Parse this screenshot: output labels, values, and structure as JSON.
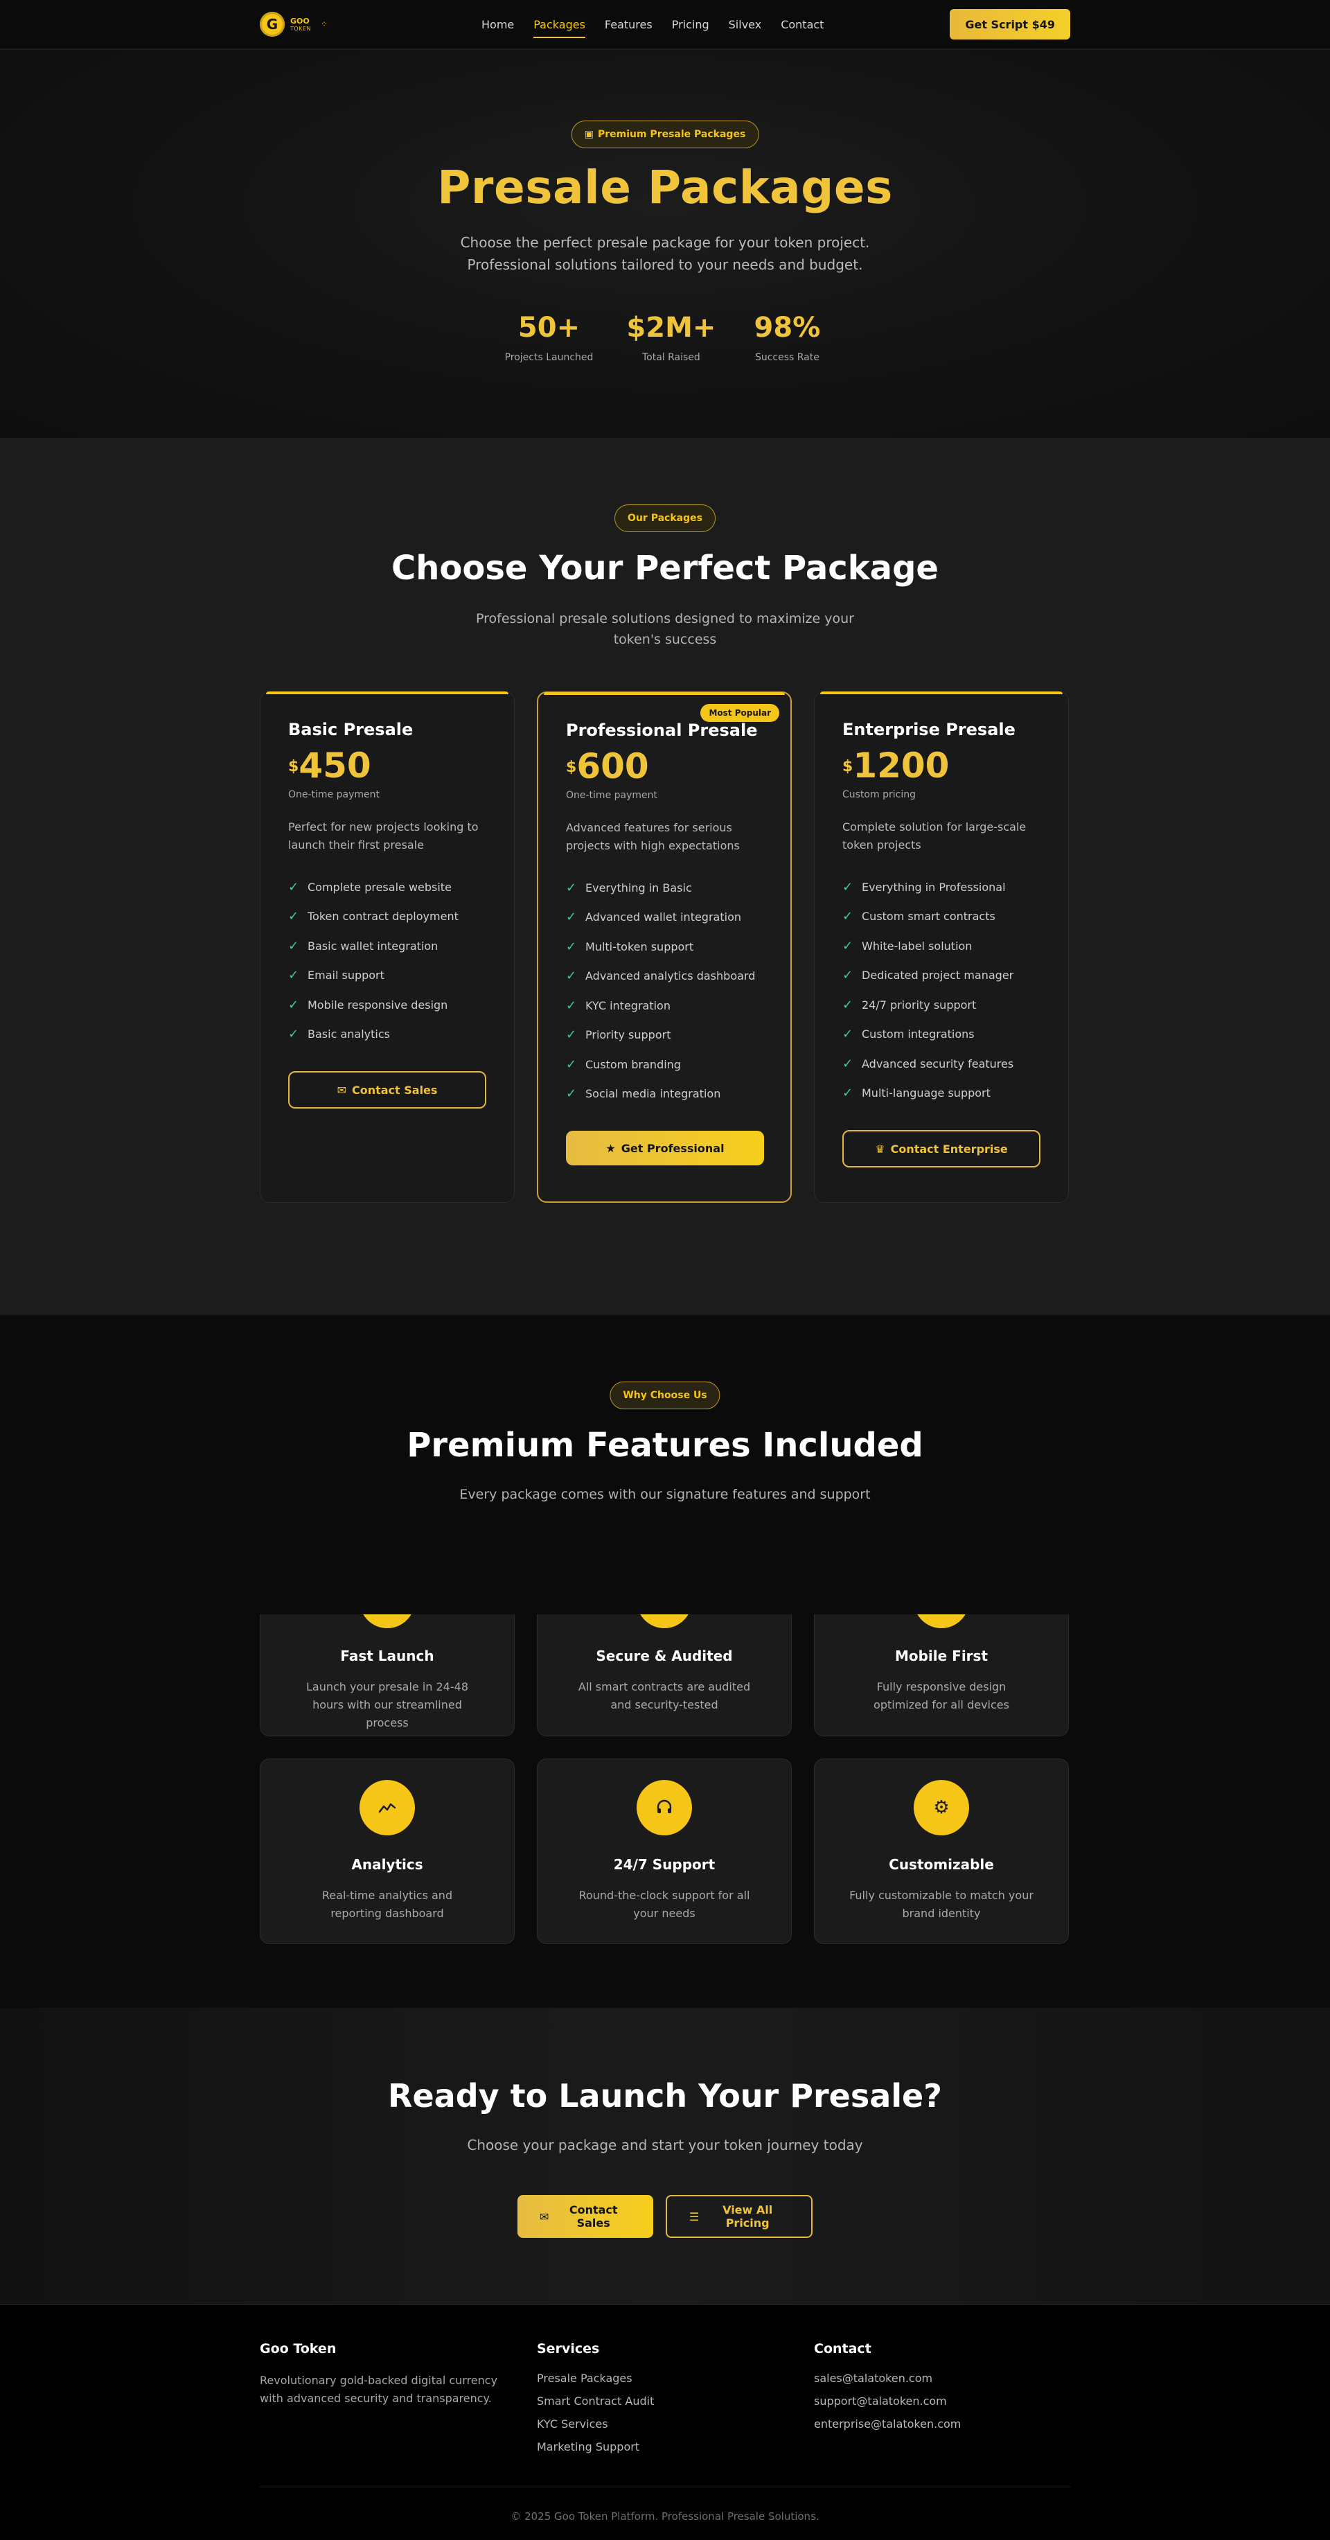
{
  "nav": {
    "logo_letter": "G",
    "logo_name": "GOO",
    "logo_sub": "TOKEN",
    "links": [
      "Home",
      "Packages",
      "Features",
      "Pricing",
      "Silvex",
      "Contact"
    ],
    "active": "Packages",
    "cta": "Get Script $49"
  },
  "hero": {
    "pill": "Premium Presale Packages",
    "title": "Presale Packages",
    "subtitle_line1": "Choose the perfect presale package for your token project.",
    "subtitle_line2": "Professional solutions tailored to your needs and budget.",
    "stats": [
      {
        "value": "50+",
        "label": "Projects Launched"
      },
      {
        "value": "$2M+",
        "label": "Total Raised"
      },
      {
        "value": "98%",
        "label": "Success Rate"
      }
    ]
  },
  "packages": {
    "pill": "Our Packages",
    "title": "Choose Your Perfect Package",
    "subtitle": "Professional presale solutions designed to maximize your token's success",
    "cards": [
      {
        "name": "Basic Presale",
        "currency": "$",
        "price": "450",
        "note": "One-time payment",
        "description": "Perfect for new projects looking to launch their first presale",
        "features": [
          "Complete presale website",
          "Token contract deployment",
          "Basic wallet integration",
          "Email support",
          "Mobile responsive design",
          "Basic analytics"
        ],
        "button": "Contact Sales",
        "button_icon": "mail-icon"
      },
      {
        "name": "Professional Presale",
        "badge": "Most Popular",
        "currency": "$",
        "price": "600",
        "note": "One-time payment",
        "description": "Advanced features for serious projects with high expectations",
        "features": [
          "Everything in Basic",
          "Advanced wallet integration",
          "Multi-token support",
          "Advanced analytics dashboard",
          "KYC integration",
          "Priority support",
          "Custom branding",
          "Social media integration"
        ],
        "button": "Get Professional",
        "button_icon": "star-icon"
      },
      {
        "name": "Enterprise Presale",
        "currency": "$",
        "price": "1200",
        "note": "Custom pricing",
        "description": "Complete solution for large-scale token projects",
        "features": [
          "Everything in Professional",
          "Custom smart contracts",
          "White-label solution",
          "Dedicated project manager",
          "24/7 priority support",
          "Custom integrations",
          "Advanced security features",
          "Multi-language support"
        ],
        "button": "Contact Enterprise",
        "button_icon": "crown-icon"
      }
    ]
  },
  "why": {
    "pill": "Why Choose Us",
    "title": "Premium Features Included",
    "subtitle": "Every package comes with our signature features and support",
    "features": [
      {
        "icon": "rocket-icon",
        "title": "Fast Launch",
        "desc": "Launch your presale in 24-48 hours with our streamlined process"
      },
      {
        "icon": "shield-icon",
        "title": "Secure & Audited",
        "desc": "All smart contracts are audited and security-tested"
      },
      {
        "icon": "mobile-icon",
        "title": "Mobile First",
        "desc": "Fully responsive design optimized for all devices"
      },
      {
        "icon": "chart-icon",
        "title": "Analytics",
        "desc": "Real-time analytics and reporting dashboard"
      },
      {
        "icon": "headset-icon",
        "title": "24/7 Support",
        "desc": "Round-the-clock support for all your needs"
      },
      {
        "icon": "gear-icon",
        "title": "Customizable",
        "desc": "Fully customizable to match your brand identity"
      }
    ]
  },
  "cta": {
    "title": "Ready to Launch Your Presale?",
    "subtitle": "Choose your package and start your token journey today",
    "primary": "Contact Sales",
    "secondary": "View All Pricing"
  },
  "footer": {
    "brand_title": "Goo Token",
    "brand_text": "Revolutionary gold-backed digital currency with advanced security and transparency.",
    "services_title": "Services",
    "services": [
      "Presale Packages",
      "Smart Contract Audit",
      "KYC Services",
      "Marketing Support"
    ],
    "contact_title": "Contact",
    "contacts": [
      "sales@talatoken.com",
      "support@talatoken.com",
      "enterprise@talatoken.com"
    ],
    "copyright": "© 2025 Goo Token Platform. Professional Presale Solutions."
  },
  "colors": {
    "accent": "#f5c518",
    "accent_text": "#f0c43a",
    "check": "#3ecf8e",
    "page_bg": "#0b0b0b",
    "section_bg": "#1c1c1c"
  }
}
